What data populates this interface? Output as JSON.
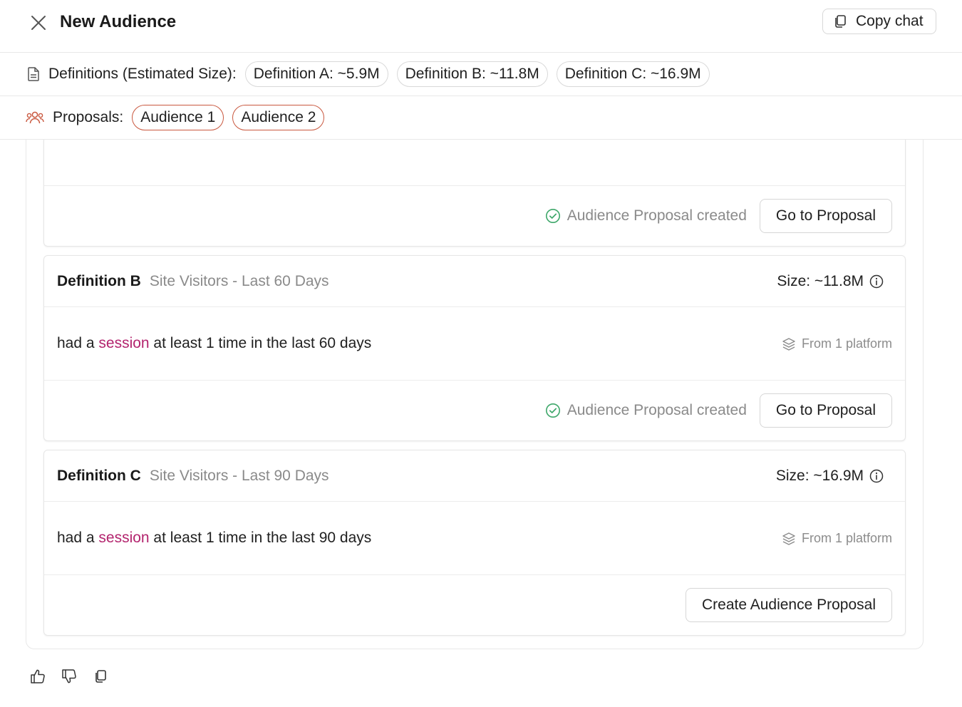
{
  "header": {
    "title": "New Audience",
    "copy_chat_label": "Copy chat"
  },
  "definitions_bar": {
    "label": "Definitions (Estimated Size):",
    "chips": [
      {
        "label": "Definition A: ~5.9M"
      },
      {
        "label": "Definition B: ~11.8M"
      },
      {
        "label": "Definition C: ~16.9M"
      }
    ]
  },
  "proposals_bar": {
    "label": "Proposals:",
    "chips": [
      {
        "label": "Audience 1"
      },
      {
        "label": "Audience 2"
      }
    ]
  },
  "cards": [
    {
      "status": "Audience Proposal created",
      "action_label": "Go to Proposal"
    },
    {
      "name": "Definition B",
      "subtitle": "Site Visitors - Last 60 Days",
      "size": "Size: ~11.8M",
      "rule": {
        "prefix": "had a ",
        "keyword": "session",
        "suffix": " at least 1 time in the last 60 days"
      },
      "platform": "From 1 platform",
      "status": "Audience Proposal created",
      "action_label": "Go to Proposal"
    },
    {
      "name": "Definition C",
      "subtitle": "Site Visitors - Last 90 Days",
      "size": "Size: ~16.9M",
      "rule": {
        "prefix": "had a ",
        "keyword": "session",
        "suffix": " at least 1 time in the last 90 days"
      },
      "platform": "From 1 platform",
      "action_label": "Create Audience Proposal"
    }
  ],
  "colors": {
    "keyword": "#b3246e",
    "success": "#3ea76a",
    "proposal_accent": "#c9583f"
  },
  "icons": {
    "close": "close-icon",
    "copy": "copy-icon",
    "document": "document-icon",
    "users": "users-icon",
    "check_circle": "check-circle-icon",
    "info": "info-icon",
    "layers": "layers-icon",
    "thumbs_up": "thumbs-up-icon",
    "thumbs_down": "thumbs-down-icon"
  }
}
